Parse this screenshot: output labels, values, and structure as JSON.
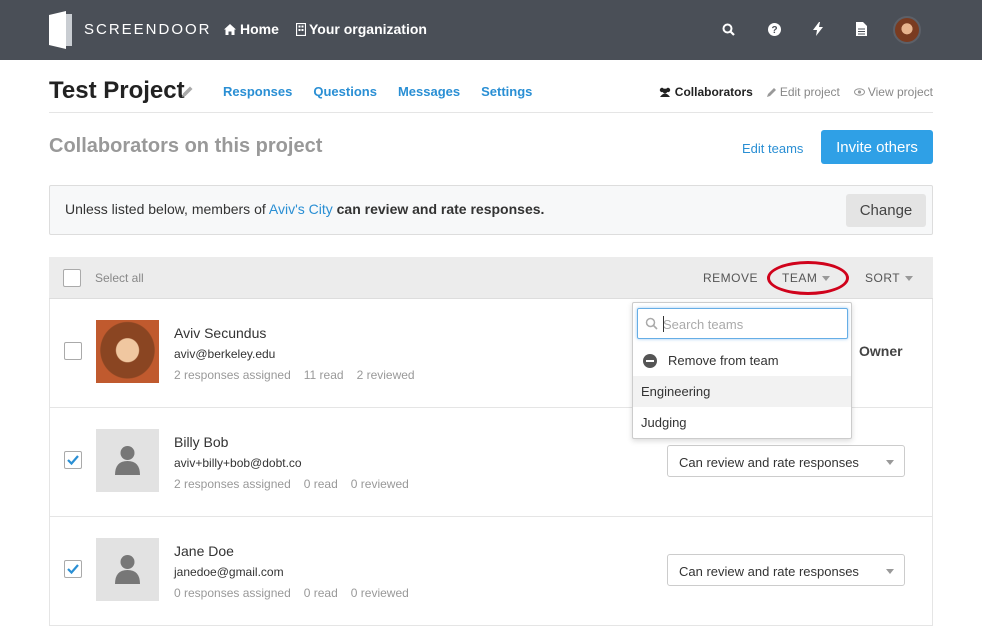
{
  "app": {
    "brand": "SCREENDOOR"
  },
  "topnav": {
    "home": "Home",
    "org": "Your organization"
  },
  "project": {
    "title": "Test Project",
    "tabs": [
      "Responses",
      "Questions",
      "Messages",
      "Settings"
    ],
    "right_links": {
      "collaborators": "Collaborators",
      "edit": "Edit project",
      "view": "View project"
    }
  },
  "section": {
    "title": "Collaborators on this project",
    "edit_teams": "Edit teams",
    "invite": "Invite others"
  },
  "notice": {
    "prefix": "Unless listed below, members of ",
    "org_link": "Aviv's City",
    "suffix": "can review and rate responses.",
    "change": "Change"
  },
  "table_head": {
    "select_all": "Select all",
    "remove": "REMOVE",
    "team": "TEAM",
    "sort": "SORT"
  },
  "dropdown": {
    "search_placeholder": "Search teams",
    "remove_label": "Remove from team",
    "teams": [
      "Engineering",
      "Judging"
    ]
  },
  "members": [
    {
      "name": "Aviv Secundus",
      "email": "aviv@berkeley.edu",
      "assigned": "2 responses assigned",
      "read": "11 read",
      "reviewed": "2 reviewed",
      "role": "Owner",
      "checked": false
    },
    {
      "name": "Billy Bob",
      "email": "aviv+billy+bob@dobt.co",
      "assigned": "2 responses assigned",
      "read": "0 read",
      "reviewed": "0 reviewed",
      "permission": "Can review and rate responses",
      "checked": true
    },
    {
      "name": "Jane Doe",
      "email": "janedoe@gmail.com",
      "assigned": "0 responses assigned",
      "read": "0 read",
      "reviewed": "0 reviewed",
      "permission": "Can review and rate responses",
      "checked": true
    }
  ],
  "colors": {
    "topbar": "#4a4f57",
    "link": "#2a8fd4",
    "primary": "#2fa0e6",
    "highlight_ring": "#d0021b",
    "check": "#2a8fd4"
  }
}
